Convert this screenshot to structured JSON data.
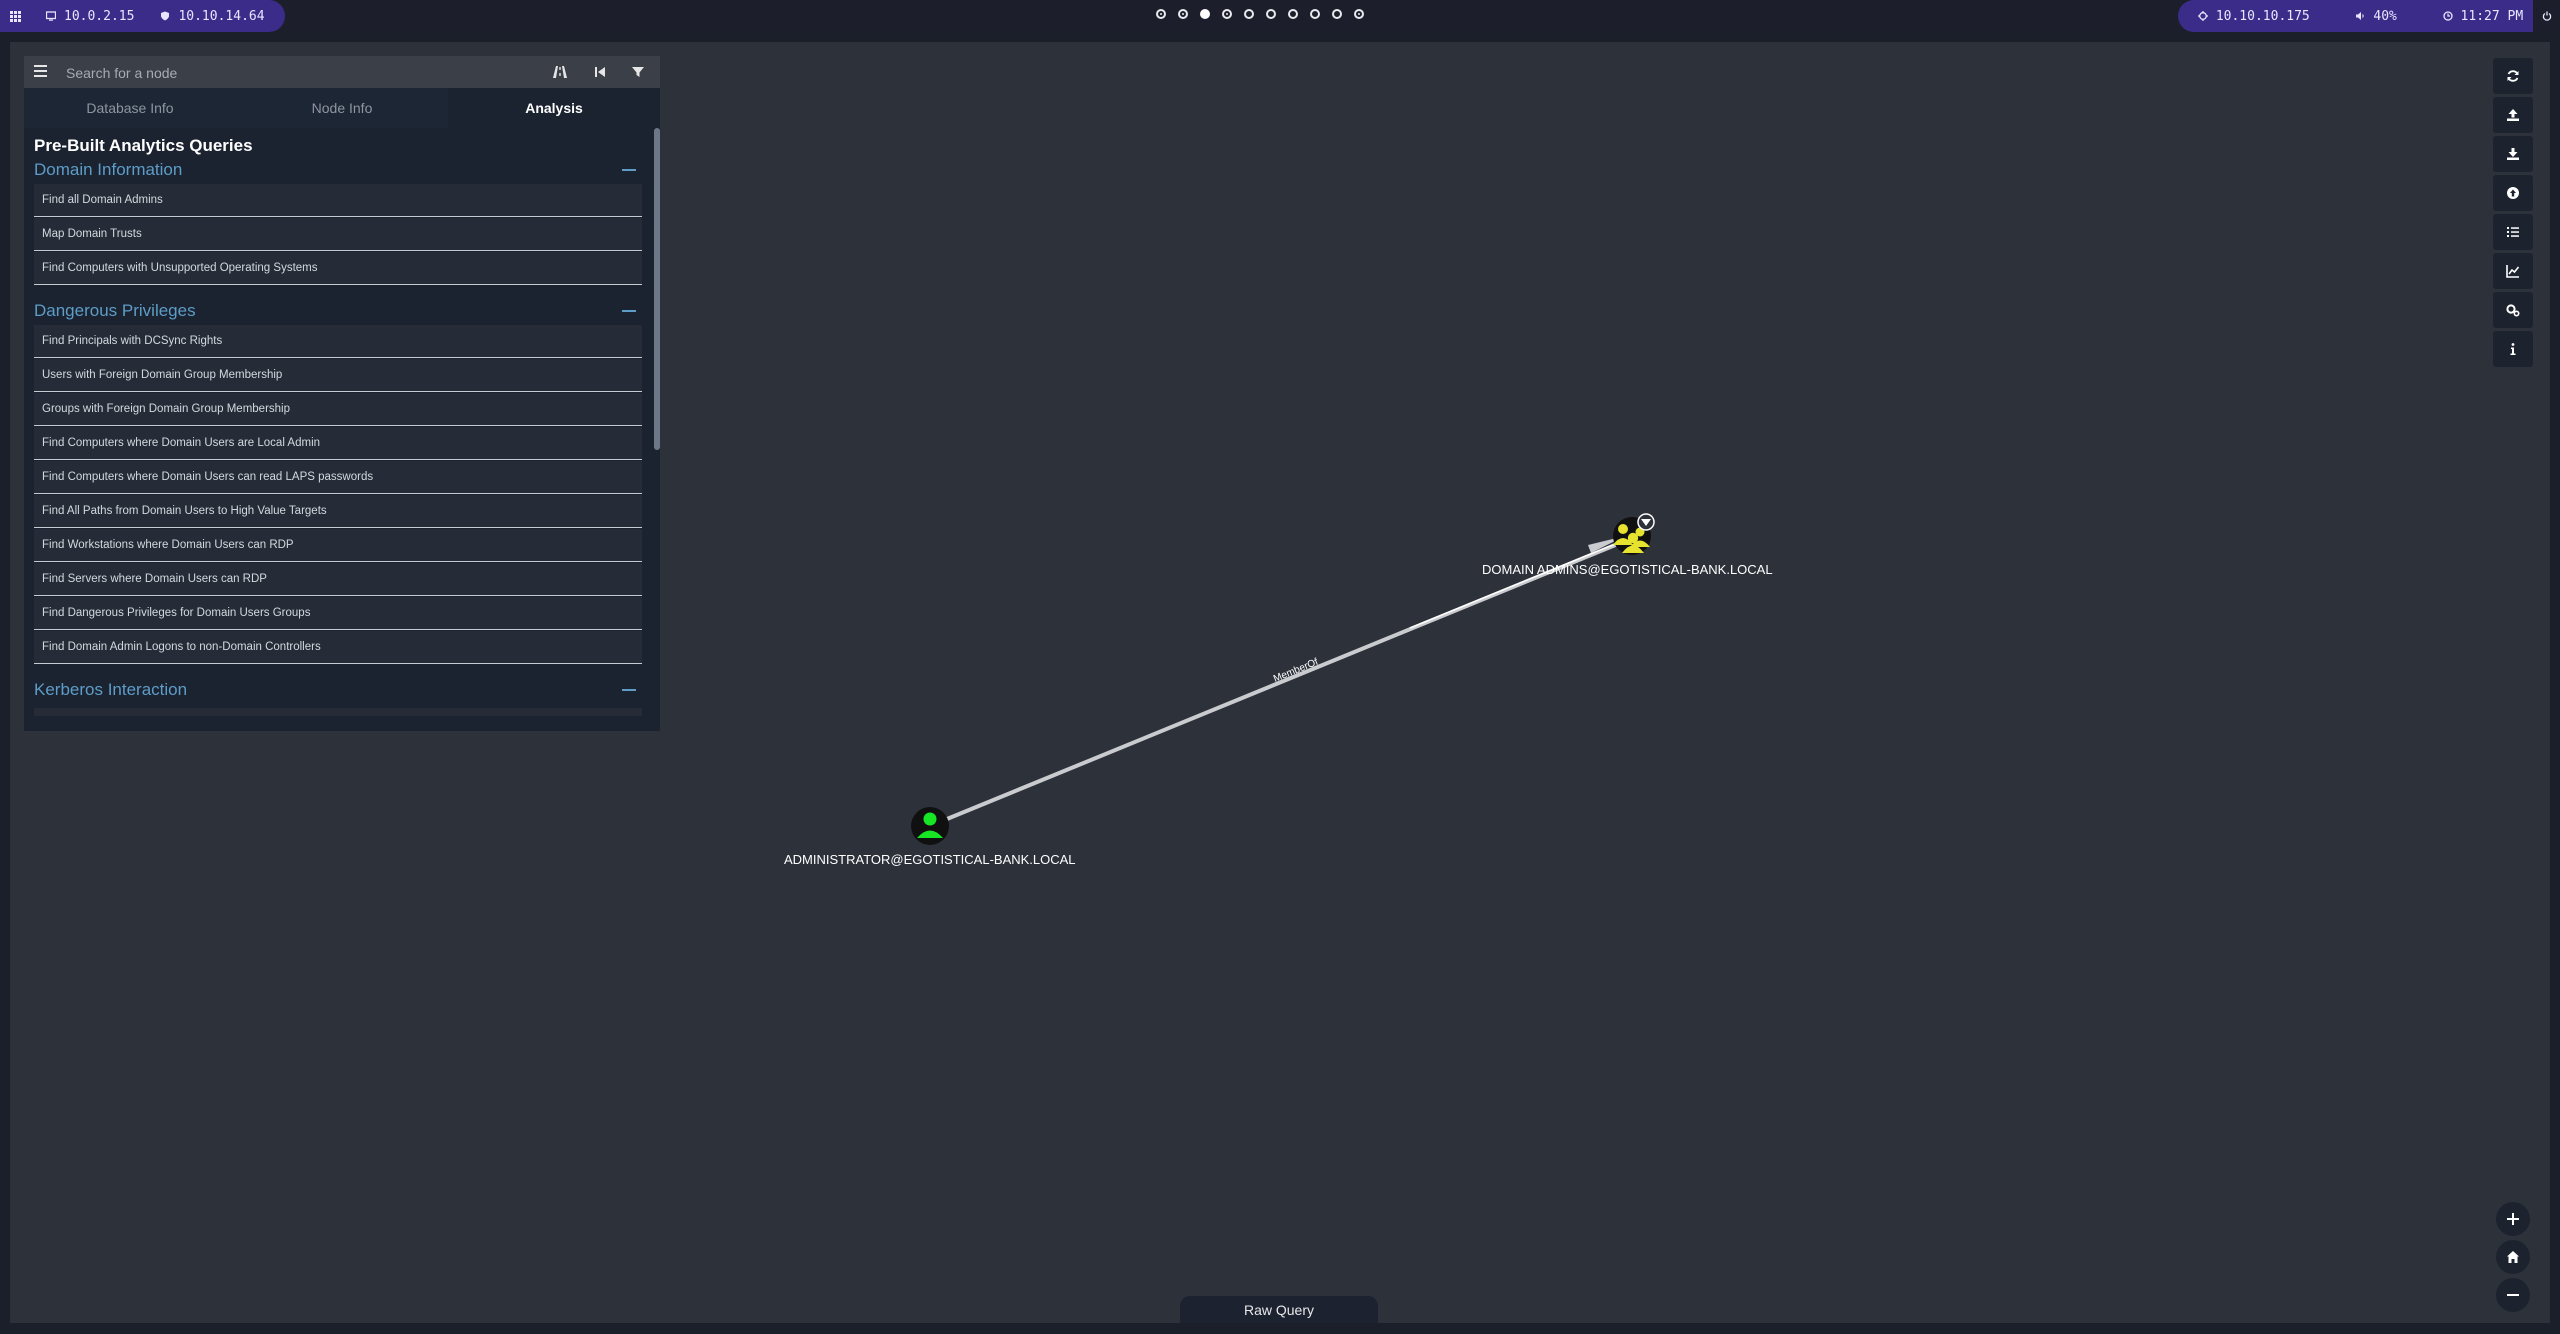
{
  "topbar": {
    "ip_local": "10.0.2.15",
    "ip_vpn": "10.10.14.64",
    "ip_target": "10.10.10.175",
    "volume": "40%",
    "time": "11:27 PM",
    "workspaces": [
      {
        "state": "dot"
      },
      {
        "state": "dot"
      },
      {
        "state": "active"
      },
      {
        "state": "dot"
      },
      {
        "state": "empty"
      },
      {
        "state": "empty"
      },
      {
        "state": "empty"
      },
      {
        "state": "empty"
      },
      {
        "state": "empty"
      },
      {
        "state": "dot"
      }
    ]
  },
  "search": {
    "placeholder": "Search for a node"
  },
  "tabs": [
    {
      "label": "Database Info"
    },
    {
      "label": "Node Info"
    },
    {
      "label": "Analysis"
    }
  ],
  "analysis": {
    "title": "Pre-Built Analytics Queries",
    "sections": [
      {
        "title": "Domain Information",
        "queries": [
          "Find all Domain Admins",
          "Map Domain Trusts",
          "Find Computers with Unsupported Operating Systems"
        ]
      },
      {
        "title": "Dangerous Privileges",
        "queries": [
          "Find Principals with DCSync Rights",
          "Users with Foreign Domain Group Membership",
          "Groups with Foreign Domain Group Membership",
          "Find Computers where Domain Users are Local Admin",
          "Find Computers where Domain Users can read LAPS passwords",
          "Find All Paths from Domain Users to High Value Targets",
          "Find Workstations where Domain Users can RDP",
          "Find Servers where Domain Users can RDP",
          "Find Dangerous Privileges for Domain Users Groups",
          "Find Domain Admin Logons to non-Domain Controllers"
        ]
      },
      {
        "title": "Kerberos Interaction",
        "queries": []
      }
    ]
  },
  "graph": {
    "nodes": {
      "group": {
        "label": "DOMAIN ADMINS@EGOTISTICAL-BANK.LOCAL",
        "icon": "group-icon",
        "color": "#e6e22e"
      },
      "user": {
        "label": "ADMINISTRATOR@EGOTISTICAL-BANK.LOCAL",
        "icon": "user-icon",
        "color": "#17e625"
      }
    },
    "edge": {
      "label": "MemberOf"
    }
  },
  "toolbar": [
    "refresh-icon",
    "upload-icon",
    "download-icon",
    "import-icon",
    "list-icon",
    "chart-icon",
    "settings-icon",
    "info-icon"
  ],
  "raw_query": {
    "label": "Raw Query"
  },
  "colors": {
    "accent": "#5d9dc7",
    "app_bg": "#2c313a",
    "topbar_accent": "#3b2c8a"
  }
}
